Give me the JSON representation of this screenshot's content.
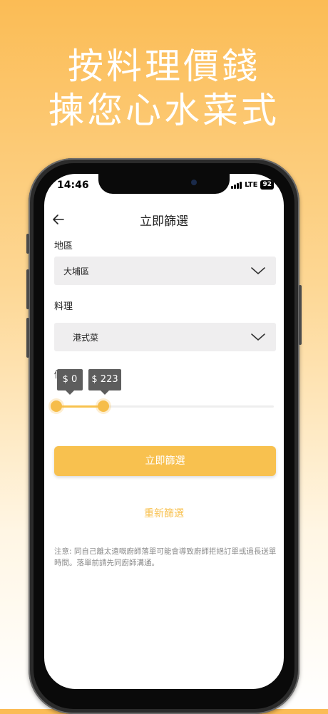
{
  "headline": {
    "line1": "按料理價錢",
    "line2": "揀您心水菜式"
  },
  "status_bar": {
    "time": "14:46",
    "network": "LTE",
    "battery": "92"
  },
  "nav": {
    "title": "立即篩選"
  },
  "filters": {
    "region_label": "地區",
    "region_value": "大埔區",
    "cuisine_label": "料理",
    "cuisine_value": "港式菜",
    "price_label": "價錢",
    "price_min": "$ 0",
    "price_max": "$ 223",
    "price_max_fraction": 0.22
  },
  "actions": {
    "apply_label": "立即篩選",
    "reset_label": "重新篩選"
  },
  "note": "注意: 同自己離太遠嘅廚師落單可能會導致廚師拒絕訂單或過長送單時間。落單前請先同廚師溝通。",
  "colors": {
    "accent": "#f8c14f",
    "field_bg": "#efeeef",
    "tooltip": "#5d5d5d"
  }
}
